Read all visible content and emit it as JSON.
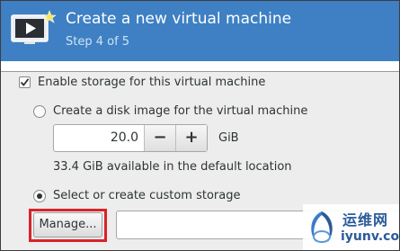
{
  "header": {
    "title": "Create a new virtual machine",
    "step": "Step 4 of 5",
    "icon": "monitor-play-icon"
  },
  "storage": {
    "enable_label": "Enable storage for this virtual machine",
    "enable_checked": true,
    "create_disk_label": "Create a disk image for the virtual machine",
    "create_disk_selected": false,
    "disk_size_value": "20.0",
    "decrement_label": "−",
    "increment_label": "+",
    "unit": "GiB",
    "available_text": "33.4 GiB available in the default location",
    "custom_label": "Select or create custom storage",
    "custom_selected": true,
    "manage_label": "Manage...",
    "path_value": ""
  },
  "watermark": {
    "chinese": "运维网",
    "url": "iyunv.com"
  },
  "colors": {
    "header_bg": "#3e80c3",
    "highlight": "#d8232a"
  }
}
